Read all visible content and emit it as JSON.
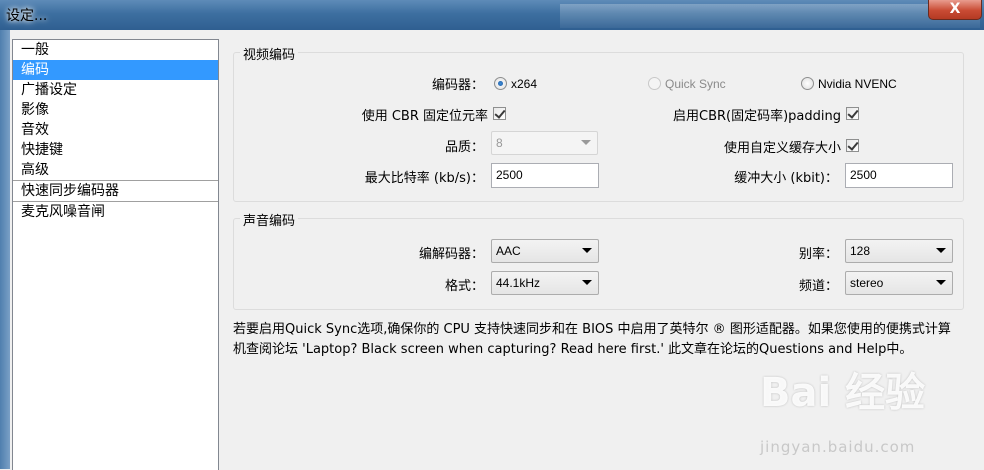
{
  "window": {
    "title": "设定...",
    "close_label": "X"
  },
  "sidebar": {
    "items": [
      {
        "label": "一般"
      },
      {
        "label": "编码"
      },
      {
        "label": "广播设定"
      },
      {
        "label": "影像"
      },
      {
        "label": "音效"
      },
      {
        "label": "快捷键"
      },
      {
        "label": "高级"
      },
      {
        "label": "快速同步编码器"
      },
      {
        "label": "麦克风噪音闸"
      }
    ],
    "selected_index": 1
  },
  "video": {
    "group_title": "视频编码",
    "encoder_label": "编码器：",
    "encoder_options": [
      {
        "label": "x264",
        "selected": true,
        "enabled": true
      },
      {
        "label": "Quick Sync",
        "selected": false,
        "enabled": false
      },
      {
        "label": "Nvidia NVENC",
        "selected": false,
        "enabled": true
      }
    ],
    "use_cbr_label": "使用 CBR 固定位元率",
    "use_cbr_checked": true,
    "cbr_padding_label": "启用CBR(固定码率)padding",
    "cbr_padding_checked": true,
    "quality_label": "品质：",
    "quality_value": "8",
    "custom_buffer_label": "使用自定义缓存大小",
    "custom_buffer_checked": true,
    "max_bitrate_label": "最大比特率 (kb/s)：",
    "max_bitrate_value": "2500",
    "buffer_size_label": "缓冲大小 (kbit)：",
    "buffer_size_value": "2500"
  },
  "audio": {
    "group_title": "声音编码",
    "codec_label": "编解码器：",
    "codec_value": "AAC",
    "bitrate_label": "别率：",
    "bitrate_value": "128",
    "format_label": "格式：",
    "format_value": "44.1kHz",
    "channel_label": "频道：",
    "channel_value": "stereo"
  },
  "notice": "若要启用Quick Sync选项,确保你的 CPU 支持快速同步和在 BIOS 中启用了英特尔 ® 图形适配器。如果您使用的便携式计算机查阅论坛 'Laptop? Black screen when capturing? Read here first.' 此文章在论坛的Questions and Help中。",
  "watermark": {
    "main": "Bai 经验",
    "url": "jingyan.baidu.com"
  }
}
